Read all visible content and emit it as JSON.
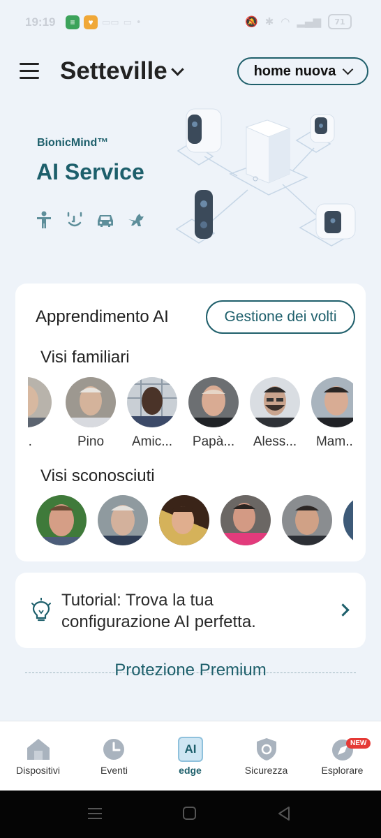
{
  "status_bar": {
    "time": "19:19",
    "battery": "71"
  },
  "header": {
    "home_name": "Setteville",
    "home_selector": "home nuova"
  },
  "banner": {
    "brand_small": "BionicMind™",
    "brand_title": "AI Service"
  },
  "ai_card": {
    "title": "Apprendimento AI",
    "manage_faces_button": "Gestione dei volti",
    "familiar_title": "Visi familiari",
    "familiar_faces": [
      {
        "name": "..."
      },
      {
        "name": "Pino"
      },
      {
        "name": "Amic..."
      },
      {
        "name": "Papà..."
      },
      {
        "name": "Aless..."
      },
      {
        "name": "Mam..."
      }
    ],
    "unknown_title": "Visi sconosciuti"
  },
  "tutorial": {
    "text": "Tutorial: Trova la tua configurazione AI perfetta."
  },
  "premium": {
    "title": "Protezione Premium"
  },
  "bottom_nav": {
    "items": [
      {
        "label": "Dispositivi"
      },
      {
        "label": "Eventi"
      },
      {
        "label": "edge",
        "icon_text": "AI"
      },
      {
        "label": "Sicurezza"
      },
      {
        "label": "Esplorare",
        "badge": "NEW"
      }
    ]
  },
  "colors": {
    "accent": "#1d5f6b",
    "background": "#eef3f9",
    "badge": "#e53935"
  }
}
